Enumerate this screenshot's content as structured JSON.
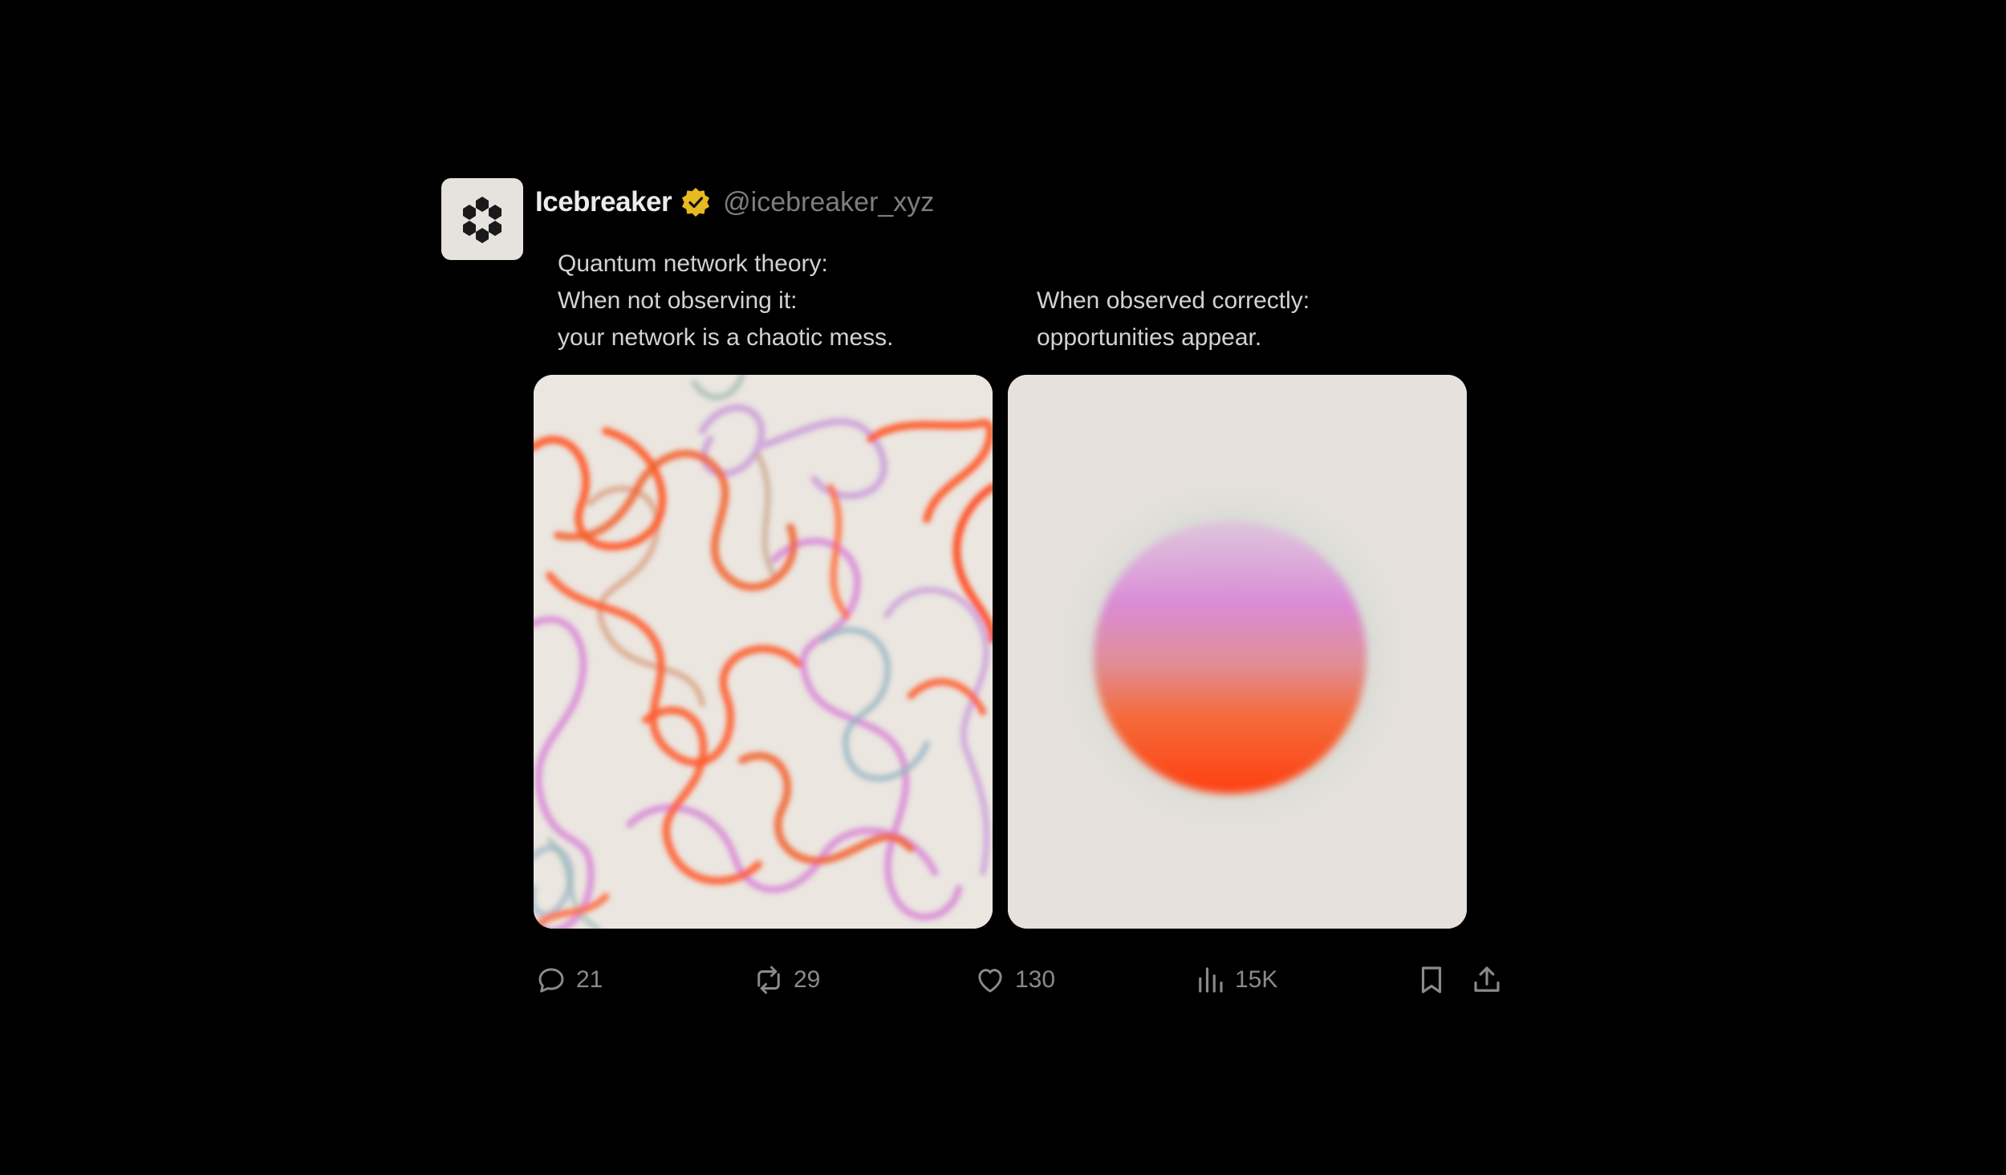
{
  "account": {
    "display_name": "Icebreaker",
    "handle": "@icebreaker_xyz",
    "verified": true,
    "avatar_icon": "hexagon-cluster-logo-icon",
    "badge_color": "#e8b921"
  },
  "post": {
    "caption_left": [
      "Quantum network theory:",
      "When not observing it:",
      "your network is a chaotic mess."
    ],
    "caption_right": [
      "When observed correctly:",
      "opportunities appear."
    ],
    "media": [
      {
        "name": "chaotic-scribble-image",
        "description_icon": "tangled-lines-image"
      },
      {
        "name": "gradient-sphere-image",
        "description_icon": "glowing-orb-image"
      }
    ]
  },
  "actions": {
    "reply_count": "21",
    "repost_count": "29",
    "like_count": "130",
    "views_count": "15K",
    "icons": [
      "reply-icon",
      "repost-icon",
      "like-icon",
      "views-icon",
      "bookmark-icon",
      "share-icon"
    ]
  },
  "colors": {
    "background": "#000000",
    "text_primary": "#ececec",
    "text_secondary": "#7e7e7e",
    "orange": "#ff4a1c",
    "pink": "#d98ad6",
    "teal": "#8fb7b0"
  }
}
